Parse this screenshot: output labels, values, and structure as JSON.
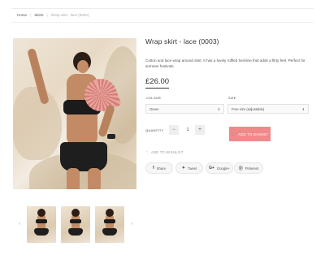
{
  "breadcrumb": {
    "home": "Home",
    "category": "Skirts",
    "current": "Wrap skirt - lace (0003)"
  },
  "product": {
    "title": "Wrap skirt - lace (0003)",
    "description": "Cotton and lace wrap around skirt. It has a lovely ruffled hemline that adds a flirty feel. Perfect for summer festivals.",
    "price": "£26.00"
  },
  "options": {
    "colour_label": "COLOUR",
    "colour_value": "Green",
    "size_label": "SIZE",
    "size_value": "Free size (adjustable)"
  },
  "quantity": {
    "label": "QUANTITY",
    "minus": "−",
    "plus": "+",
    "value": "1"
  },
  "add_to_basket": "ADD TO BASKET",
  "wishlist": "ADD TO WISHLIST",
  "social": {
    "share": "Share",
    "tweet": "Tweet",
    "google": "Google+",
    "pinterest": "Pinterest"
  },
  "thumbnails": {
    "prev": "‹",
    "next": "›"
  }
}
